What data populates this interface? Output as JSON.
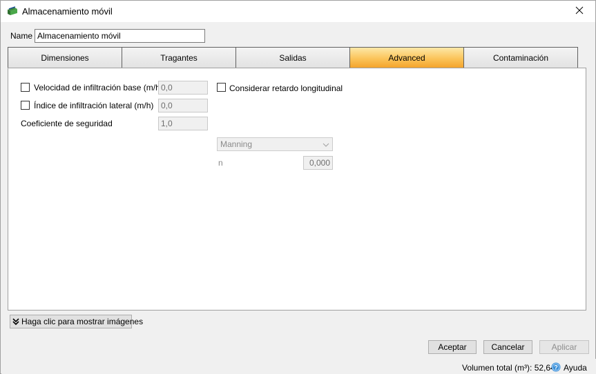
{
  "window": {
    "title": "Almacenamiento móvil",
    "close_glyph": "✕"
  },
  "name_field": {
    "label": "Name",
    "value": "Almacenamiento móvil"
  },
  "tabs": [
    {
      "label": "Dimensiones",
      "active": false
    },
    {
      "label": "Tragantes",
      "active": false
    },
    {
      "label": "Salidas",
      "active": false
    },
    {
      "label": "Advanced",
      "active": true
    },
    {
      "label": "Contaminación",
      "active": false
    }
  ],
  "advanced": {
    "infiltration_base": {
      "label": "Velocidad de infiltración base (m/h)",
      "checked": false,
      "value": "0,0"
    },
    "infiltration_lateral": {
      "label": "Índice de infiltración lateral (m/h)",
      "checked": false,
      "value": "0,0"
    },
    "safety_coefficient": {
      "label": "Coeficiente de seguridad",
      "value": "1,0"
    },
    "longitudinal_delay": {
      "label": "Considerar retardo longitudinal",
      "checked": false
    },
    "roughness_method": {
      "selected": "Manning"
    },
    "n_coefficient": {
      "label": "n",
      "value": "0,000"
    }
  },
  "show_images_button": {
    "label": "Haga clic para mostrar imágenes"
  },
  "buttons": {
    "accept": "Aceptar",
    "cancel": "Cancelar",
    "apply": "Aplicar"
  },
  "status": {
    "total_volume": "Volumen total (m³): 52,640",
    "help": "Ayuda"
  },
  "colors": {
    "active_tab_accent": "#fbc45a",
    "help_icon": "#3a8fd8"
  }
}
